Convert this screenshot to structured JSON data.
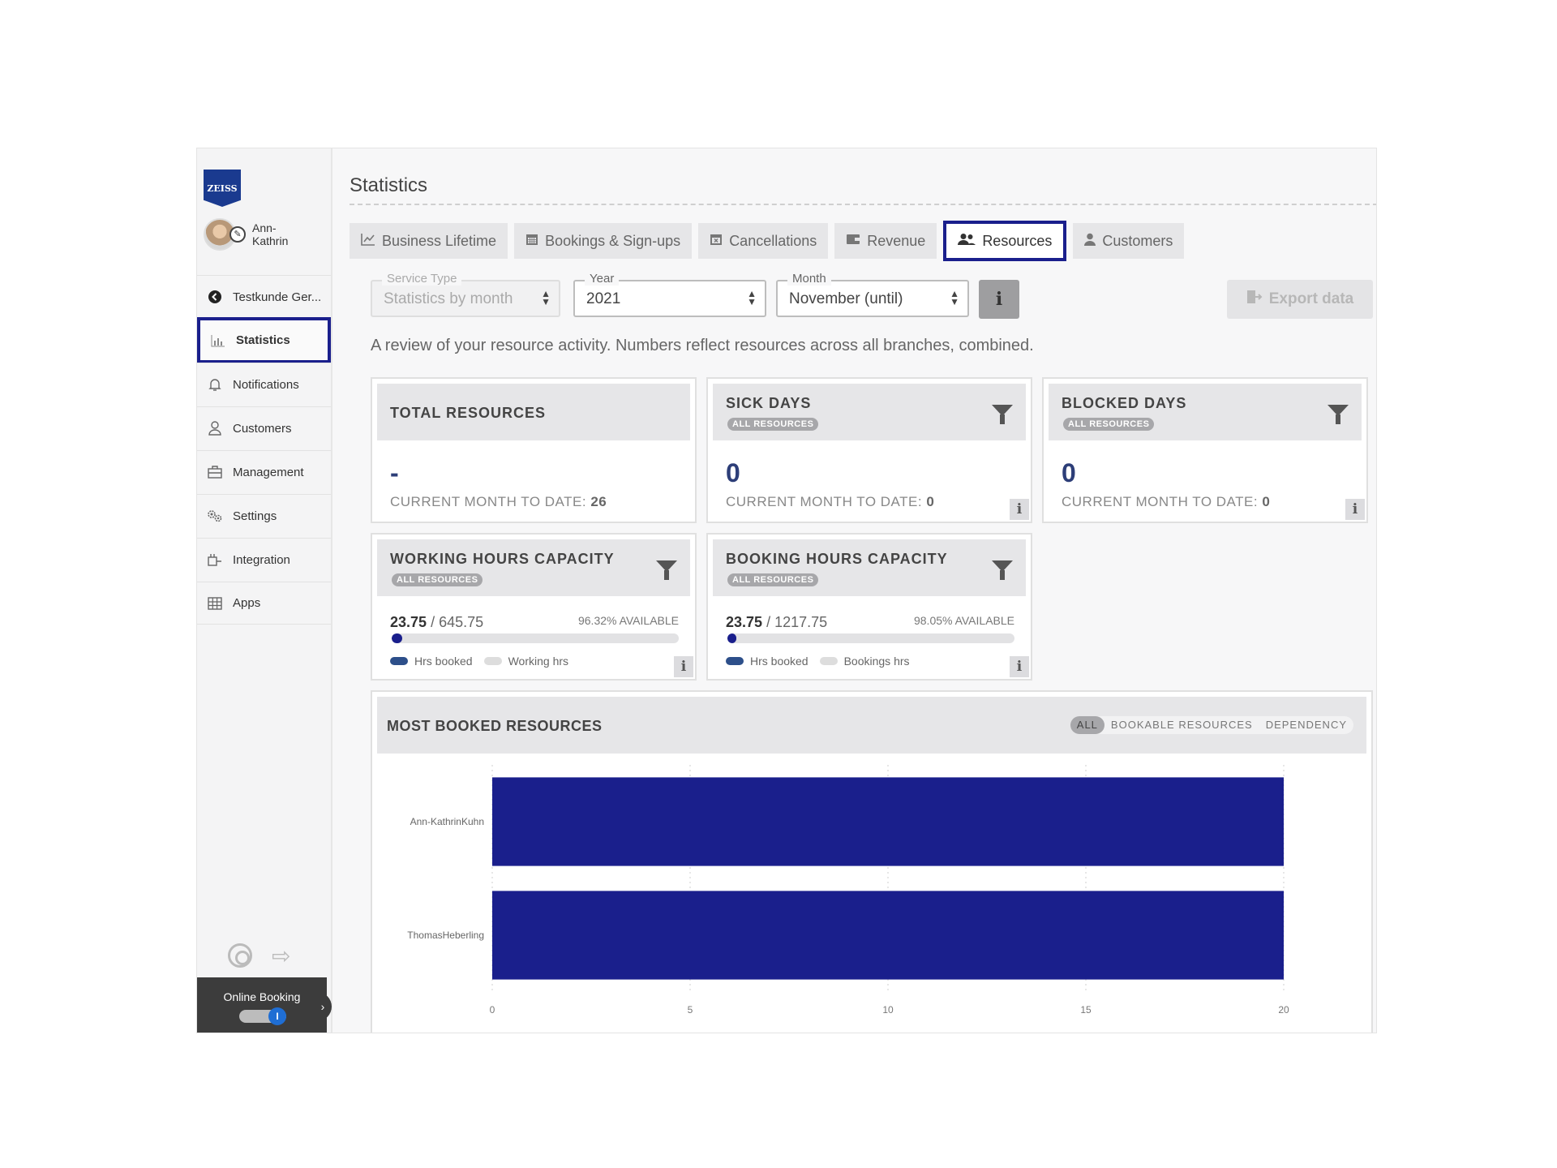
{
  "app": {
    "logo_text": "ZEISS",
    "user_name": "Ann-Kathrin",
    "sidebar": {
      "items": [
        {
          "label": "Testkunde Ger...",
          "icon": "arrow-left-circle-icon"
        },
        {
          "label": "Statistics",
          "icon": "bar-chart-icon",
          "active": true
        },
        {
          "label": "Notifications",
          "icon": "bell-icon"
        },
        {
          "label": "Customers",
          "icon": "user-icon"
        },
        {
          "label": "Management",
          "icon": "briefcase-icon"
        },
        {
          "label": "Settings",
          "icon": "gears-icon"
        },
        {
          "label": "Integration",
          "icon": "plug-icon"
        },
        {
          "label": "Apps",
          "icon": "grid-icon"
        }
      ],
      "online_booking_label": "Online Booking",
      "online_booking_enabled": true
    }
  },
  "main": {
    "title": "Statistics",
    "tabs": [
      {
        "label": "Business Lifetime",
        "icon": "line-chart-icon"
      },
      {
        "label": "Bookings & Sign-ups",
        "icon": "calendar-icon"
      },
      {
        "label": "Cancellations",
        "icon": "calendar-x-icon"
      },
      {
        "label": "Revenue",
        "icon": "wallet-icon"
      },
      {
        "label": "Resources",
        "icon": "users-icon",
        "active": true
      },
      {
        "label": "Customers",
        "icon": "user-icon"
      }
    ],
    "filters": {
      "service_type": {
        "label": "Service Type",
        "value": "Statistics by month",
        "disabled": true
      },
      "year": {
        "label": "Year",
        "value": "2021"
      },
      "month": {
        "label": "Month",
        "value": "November (until)"
      }
    },
    "info_button": "i",
    "export_label": "Export data",
    "description": "A review of your resource activity. Numbers reflect resources across all branches, combined.",
    "cards": {
      "total_resources": {
        "title": "TOTAL RESOURCES",
        "value": "-",
        "month_label": "CURRENT MONTH TO DATE:",
        "month_value": "26"
      },
      "sick_days": {
        "title": "SICK DAYS",
        "badge": "ALL RESOURCES",
        "value": "0",
        "month_label": "CURRENT MONTH TO DATE:",
        "month_value": "0"
      },
      "blocked_days": {
        "title": "BLOCKED DAYS",
        "badge": "ALL RESOURCES",
        "value": "0",
        "month_label": "CURRENT MONTH TO DATE:",
        "month_value": "0"
      },
      "working_hours": {
        "title": "WORKING HOURS CAPACITY",
        "badge": "ALL RESOURCES",
        "booked": "23.75",
        "total": "/ 645.75",
        "available": "96.32% AVAILABLE",
        "booked_fraction": 0.0368,
        "legend_booked": "Hrs booked",
        "legend_total": "Working hrs"
      },
      "booking_hours": {
        "title": "BOOKING HOURS CAPACITY",
        "badge": "ALL RESOURCES",
        "booked": "23.75",
        "total": "/ 1217.75",
        "available": "98.05% AVAILABLE",
        "booked_fraction": 0.0195,
        "legend_booked": "Hrs booked",
        "legend_total": "Bookings hrs"
      }
    },
    "info_mini": "i",
    "most_booked": {
      "title": "MOST BOOKED RESOURCES",
      "filters": [
        "ALL",
        "BOOKABLE RESOURCES",
        "DEPENDENCY"
      ],
      "active_filter": "ALL"
    }
  },
  "colors": {
    "accent": "#1a1f8c",
    "booked_legend": "#2d4f8a",
    "total_legend": "#dddddd"
  },
  "chart_data": {
    "type": "bar",
    "orientation": "horizontal",
    "categories": [
      "Ann-KathrinKuhn",
      "ThomasHeberling"
    ],
    "values": [
      20,
      20
    ],
    "xlim": [
      0,
      20
    ],
    "xticks": [
      0,
      5,
      10,
      15,
      20
    ],
    "grid": true,
    "color": "#1a1f8c"
  }
}
